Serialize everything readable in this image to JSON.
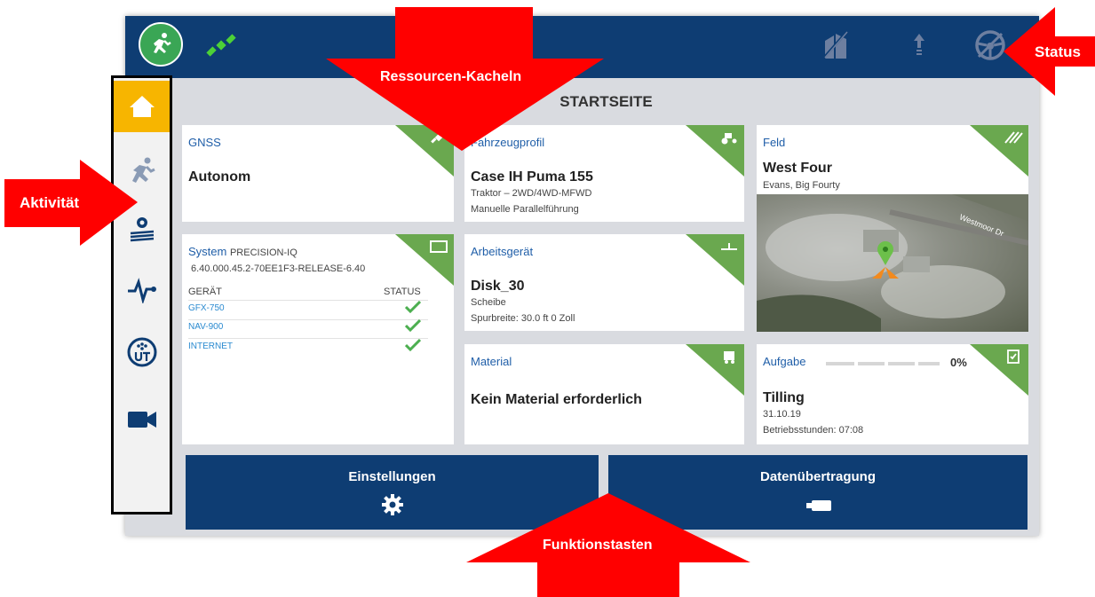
{
  "header": {
    "activity_icon": "running-person-icon",
    "gnss_icon": "satellite-icon",
    "status_icons": [
      "field-slash-icon",
      "upload-arrows-icon",
      "steering-wheel-slash-icon"
    ]
  },
  "page_title": "STARTSEITE",
  "sidebar": {
    "items": [
      {
        "icon": "home-icon",
        "selected": true
      },
      {
        "icon": "running-person-icon"
      },
      {
        "icon": "gear-field-icon"
      },
      {
        "icon": "pulse-icon"
      },
      {
        "icon": "ut-icon"
      },
      {
        "icon": "video-camera-icon"
      }
    ]
  },
  "tiles": {
    "gnss": {
      "name": "GNSS",
      "value": "Autonom"
    },
    "system": {
      "name": "System",
      "product": "PRECISION-IQ",
      "version": "6.40.000.45.2-70EE1F3-RELEASE-6.40",
      "col_device": "GERÄT",
      "col_status": "STATUS",
      "devices": [
        "GFX-750",
        "NAV-900",
        "INTERNET"
      ]
    },
    "vehicle": {
      "name": "Fahrzeugprofil",
      "value": "Case IH Puma 155",
      "line1": "Traktor – 2WD/4WD-MFWD",
      "line2": "Manuelle Parallelführung"
    },
    "implement": {
      "name": "Arbeitsgerät",
      "value": "Disk_30",
      "line1": "Scheibe",
      "line2": "Spurbreite: 30.0 ft 0 Zoll"
    },
    "material": {
      "name": "Material",
      "value": "Kein Material erforderlich"
    },
    "field": {
      "name": "Feld",
      "value": "West Four",
      "line1": "Evans, Big Fourty",
      "map_street": "Westmoor Dr"
    },
    "task": {
      "name": "Aufgabe",
      "progress": 0,
      "progress_label": "0%",
      "value": "Tilling",
      "line1": "31.10.19",
      "line2": "Betriebsstunden: 07:08"
    }
  },
  "buttons": {
    "settings": "Einstellungen",
    "data_transfer": "Datenübertragung"
  },
  "callouts": {
    "resources": "Ressourcen-Kacheln",
    "status": "Status",
    "activity": "Aktivität",
    "function_keys": "Funktionstasten"
  },
  "colors": {
    "header": "#0e3d73",
    "accent_green": "#6aa84f",
    "home_selected": "#f7b500",
    "callout_red": "#ff0000"
  }
}
